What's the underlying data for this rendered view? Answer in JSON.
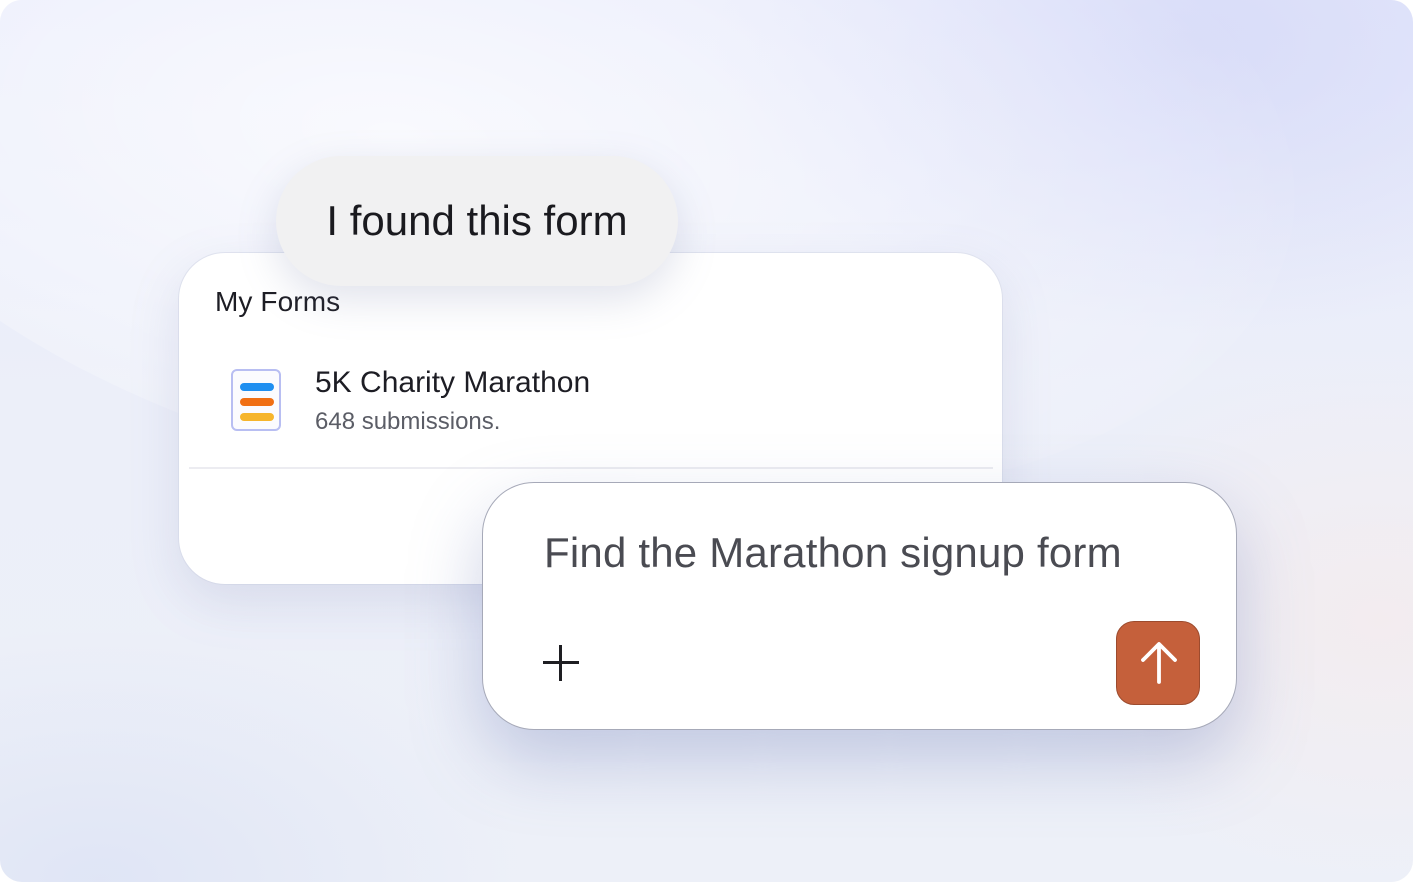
{
  "assistant_bubble": {
    "text": "I found this form"
  },
  "forms_panel": {
    "title": "My Forms",
    "items": [
      {
        "name": "5K Charity Marathon",
        "submissions": "648 submissions.",
        "icon": "form-document-icon",
        "icon_colors": [
          "#1f8ff0",
          "#f06f14",
          "#f6b52c"
        ]
      }
    ]
  },
  "prompt": {
    "text": "Find the Marathon signup form",
    "add_icon": "plus-icon",
    "send_icon": "arrow-up-icon",
    "send_color": "#c5603b"
  }
}
